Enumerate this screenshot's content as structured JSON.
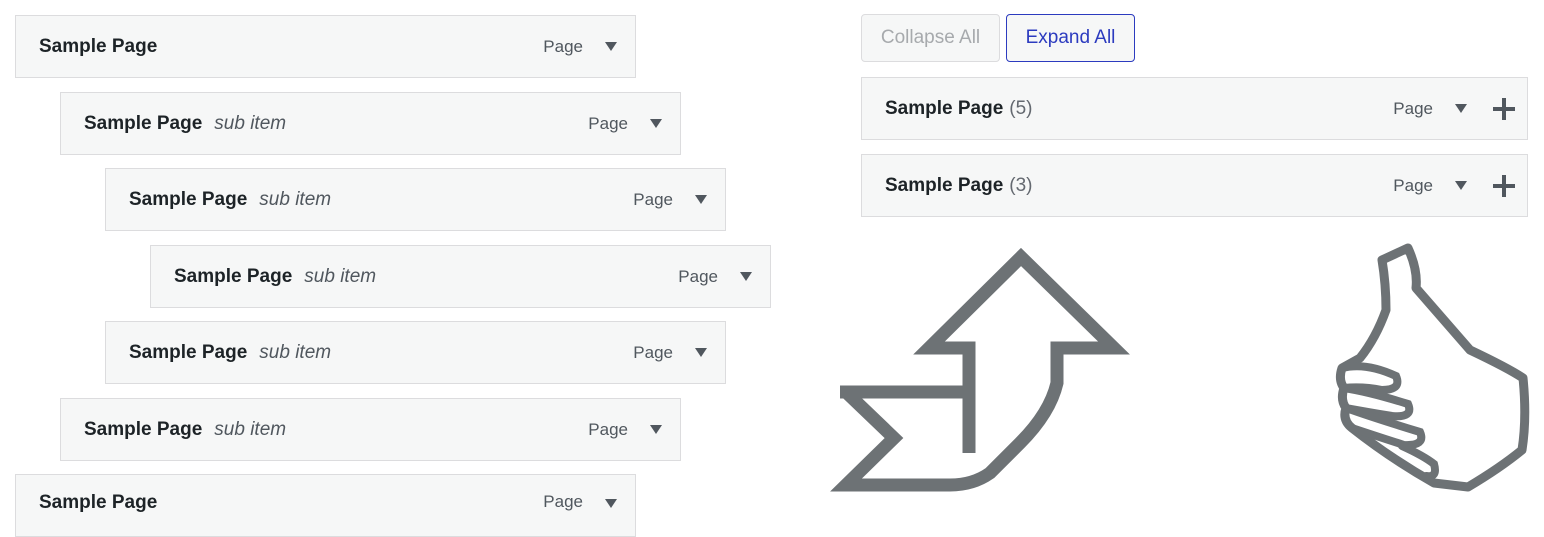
{
  "tree": {
    "items": [
      {
        "title": "Sample Page",
        "sub": "",
        "type": "Page"
      },
      {
        "title": "Sample Page",
        "sub": "sub item",
        "type": "Page"
      },
      {
        "title": "Sample Page",
        "sub": "sub item",
        "type": "Page"
      },
      {
        "title": "Sample Page",
        "sub": "sub item",
        "type": "Page"
      },
      {
        "title": "Sample Page",
        "sub": "sub item",
        "type": "Page"
      },
      {
        "title": "Sample Page",
        "sub": "sub item",
        "type": "Page"
      },
      {
        "title": "Sample Page",
        "sub": "",
        "type": "Page"
      }
    ]
  },
  "toolbar": {
    "collapse_label": "Collapse All",
    "expand_label": "Expand All"
  },
  "collapsed": {
    "items": [
      {
        "title": "Sample Page",
        "count": "(5)",
        "type": "Page"
      },
      {
        "title": "Sample Page",
        "count": "(3)",
        "type": "Page"
      }
    ]
  },
  "icons": {
    "toggle": "triangle-down-icon",
    "expand": "plus-icon",
    "pictogram_1": "curved-arrow-up-icon",
    "pictogram_2": "thumbs-up-icon"
  },
  "colors": {
    "item_background": "#f6f7f7",
    "item_border": "#dcdcde",
    "accent": "#2c3bbf",
    "icon_gray": "#6d7275"
  }
}
